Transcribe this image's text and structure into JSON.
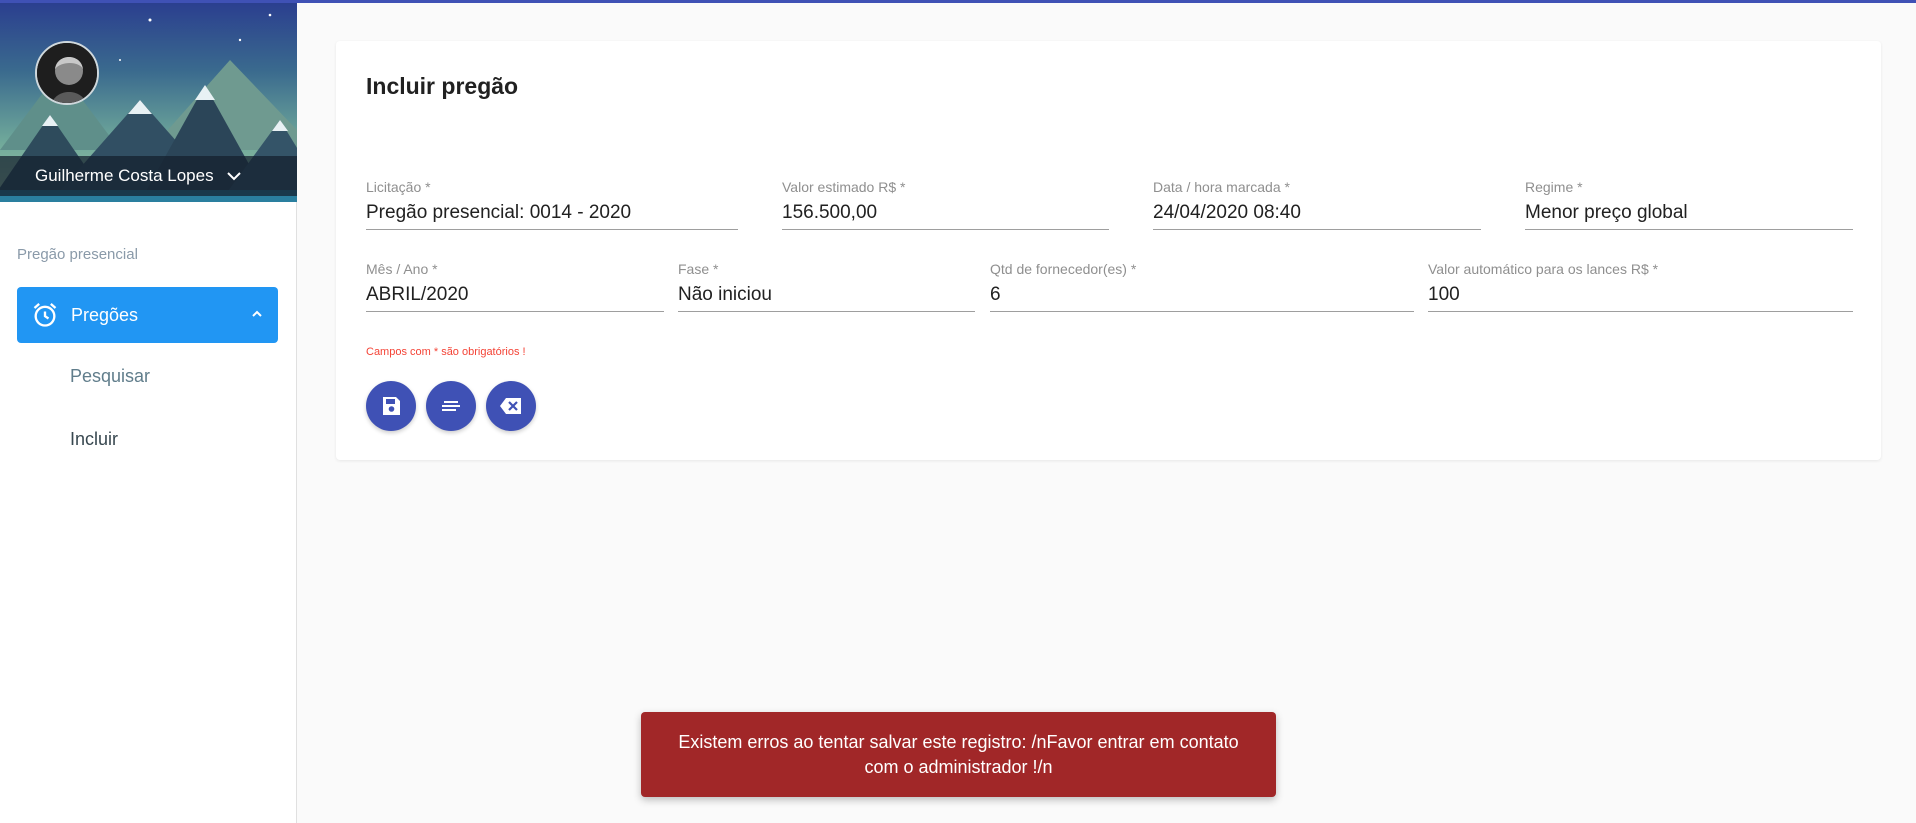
{
  "sidebar": {
    "user_name": "Guilherme Costa Lopes",
    "section_title": "Pregão presencial",
    "nav_main_label": "Pregões",
    "sub_items": [
      "Pesquisar",
      "Incluir"
    ],
    "active_color": "#2196f3"
  },
  "card": {
    "title": "Incluir pregão",
    "fields": [
      {
        "label": "Licitação *",
        "value": "Pregão presencial: 0014 - 2020"
      },
      {
        "label": "Valor estimado R$ *",
        "value": "156.500,00"
      },
      {
        "label": "Data / hora marcada *",
        "value": "24/04/2020 08:40"
      },
      {
        "label": "Regime *",
        "value": "Menor preço global"
      },
      {
        "label": "Mês / Ano *",
        "value": "ABRIL/2020"
      },
      {
        "label": "Fase *",
        "value": "Não iniciou"
      },
      {
        "label": "Qtd de fornecedor(es) *",
        "value": "6"
      },
      {
        "label": "Valor automático para os lances R$ *",
        "value": "100"
      }
    ],
    "required_note": "Campos com * são obrigatórios !",
    "buttons": [
      {
        "icon": "save-icon"
      },
      {
        "icon": "list-icon"
      },
      {
        "icon": "backspace-icon"
      }
    ]
  },
  "snackbar": {
    "message": "Existem erros ao tentar salvar este registro: /nFavor entrar em contato com o administrador !/n",
    "color": "#a12728"
  },
  "accent_color": "#3f51b5"
}
